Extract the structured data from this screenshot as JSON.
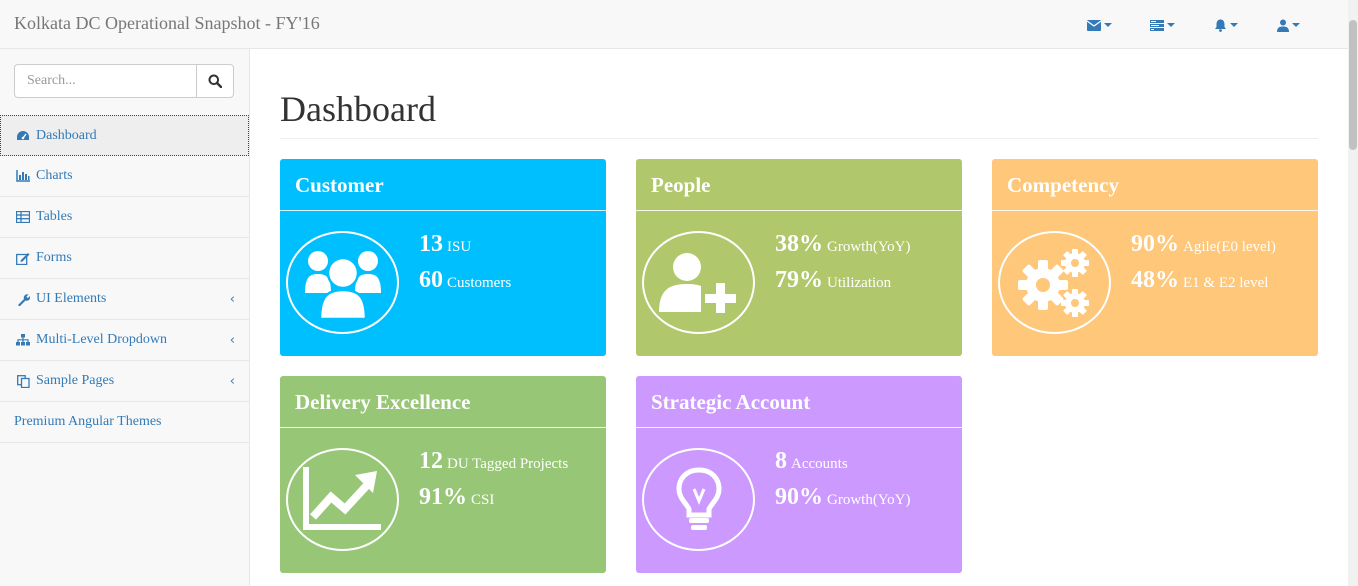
{
  "header": {
    "brand": "Kolkata DC Operational Snapshot - FY'16",
    "icons": [
      "envelope-icon",
      "tasks-icon",
      "bell-icon",
      "user-icon"
    ]
  },
  "sidebar": {
    "search_placeholder": "Search...",
    "items": [
      {
        "label": "Dashboard",
        "icon": "dashboard-icon",
        "active": true
      },
      {
        "label": "Charts",
        "icon": "bar-chart-icon"
      },
      {
        "label": "Tables",
        "icon": "table-icon"
      },
      {
        "label": "Forms",
        "icon": "edit-icon"
      },
      {
        "label": "UI Elements",
        "icon": "wrench-icon",
        "expandable": true
      },
      {
        "label": "Multi-Level Dropdown",
        "icon": "sitemap-icon",
        "expandable": true
      },
      {
        "label": "Sample Pages",
        "icon": "files-icon",
        "expandable": true
      },
      {
        "label": "Premium Angular Themes"
      }
    ]
  },
  "main": {
    "title": "Dashboard",
    "panels": [
      {
        "title": "Customer",
        "color": "#00bfff",
        "icon": "users-icon",
        "stats": [
          {
            "value": "13",
            "label": "ISU"
          },
          {
            "value": "60",
            "label": "Customers"
          }
        ]
      },
      {
        "title": "People",
        "color": "#b0c86b",
        "icon": "user-plus-icon",
        "stats": [
          {
            "value": "38%",
            "label": "Growth(YoY)"
          },
          {
            "value": "79%",
            "label": "Utilization"
          }
        ]
      },
      {
        "title": "Competency",
        "color": "#fec779",
        "icon": "gears-icon",
        "stats": [
          {
            "value": "90%",
            "label": "Agile(E0 level)"
          },
          {
            "value": "48%",
            "label": "E1 & E2 level"
          }
        ]
      },
      {
        "title": "Delivery Excellence",
        "color": "#97c677",
        "icon": "line-chart-icon",
        "stats": [
          {
            "value": "12",
            "label": "DU Tagged Projects"
          },
          {
            "value": "91%",
            "label": "CSI"
          }
        ]
      },
      {
        "title": "Strategic Account",
        "color": "#cc99ff",
        "icon": "lightbulb-icon",
        "stats": [
          {
            "value": "8",
            "label": "Accounts"
          },
          {
            "value": "90%",
            "label": "Growth(YoY)"
          }
        ]
      }
    ]
  }
}
